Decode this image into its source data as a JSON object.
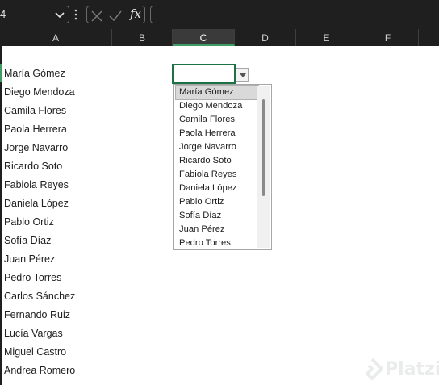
{
  "formula_bar": {
    "name_box": "4",
    "fx_label": "fx",
    "formula": ""
  },
  "columns": [
    {
      "label": "A",
      "active": false
    },
    {
      "label": "B",
      "active": false
    },
    {
      "label": "C",
      "active": true
    },
    {
      "label": "D",
      "active": false
    },
    {
      "label": "E",
      "active": false
    },
    {
      "label": "F",
      "active": false
    }
  ],
  "column_a": [
    "María Gómez",
    "Diego Mendoza",
    "Camila Flores",
    "Paola Herrera",
    "Jorge Navarro",
    "Ricardo Soto",
    "Fabiola Reyes",
    "Daniela López",
    "Pablo Ortiz",
    "Sofía Díaz",
    "Juan Pérez",
    "Pedro Torres",
    "Carlos Sánchez",
    "Fernando Ruiz",
    "Lucía Vargas",
    "Miguel Castro",
    "Andrea Romero"
  ],
  "active_cell": {
    "value": ""
  },
  "dropdown": {
    "selected_index": 0,
    "items": [
      "María Gómez",
      "Diego Mendoza",
      "Camila Flores",
      "Paola Herrera",
      "Jorge Navarro",
      "Ricardo Soto",
      "Fabiola Reyes",
      "Daniela López",
      "Pablo Ortiz",
      "Sofía Díaz",
      "Juan Pérez",
      "Pedro Torres"
    ]
  },
  "watermark": {
    "text": "Platzi"
  },
  "colors": {
    "accent": "#1e7145",
    "header_bg": "#1f1f1f",
    "watermark": "#e9ecea"
  }
}
